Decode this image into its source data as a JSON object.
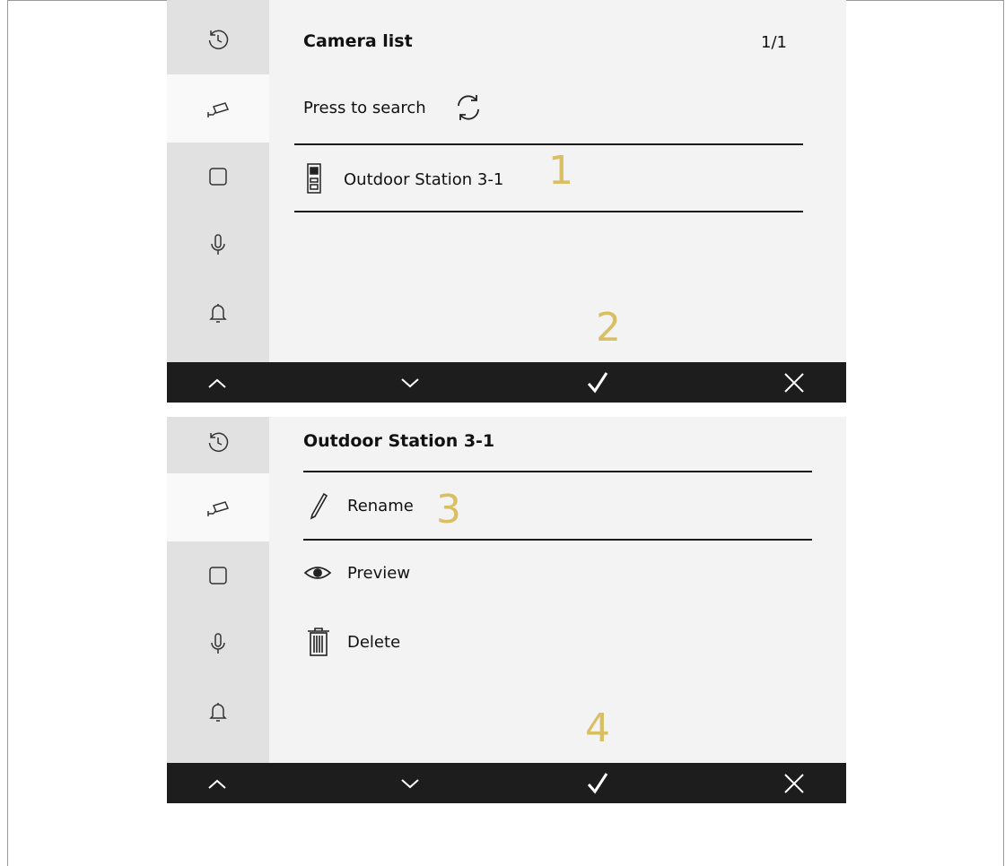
{
  "screen1": {
    "title": "Camera list",
    "pager": "1/1",
    "search_label": "Press to search",
    "items": [
      {
        "label": "Outdoor Station 3-1",
        "icon": "outdoor-station-icon"
      }
    ],
    "markers": [
      "1",
      "2"
    ]
  },
  "screen2": {
    "title": "Outdoor Station 3-1",
    "menu": [
      {
        "label": "Rename",
        "icon": "pencil-icon"
      },
      {
        "label": "Preview",
        "icon": "eye-icon"
      },
      {
        "label": "Delete",
        "icon": "trash-icon"
      }
    ],
    "markers": [
      "3",
      "4"
    ]
  },
  "sidebar_icons": [
    "history-icon",
    "camera-icon",
    "square-icon",
    "microphone-icon",
    "bell-icon"
  ],
  "bottombar_icons": [
    "chevron-up-icon",
    "chevron-down-icon",
    "checkmark-icon",
    "close-icon"
  ],
  "colors": {
    "marker": "#d9bf62",
    "bottombar": "#1d1d1d",
    "sidebar": "#e1e1e1",
    "content_bg": "#f3f3f3"
  }
}
